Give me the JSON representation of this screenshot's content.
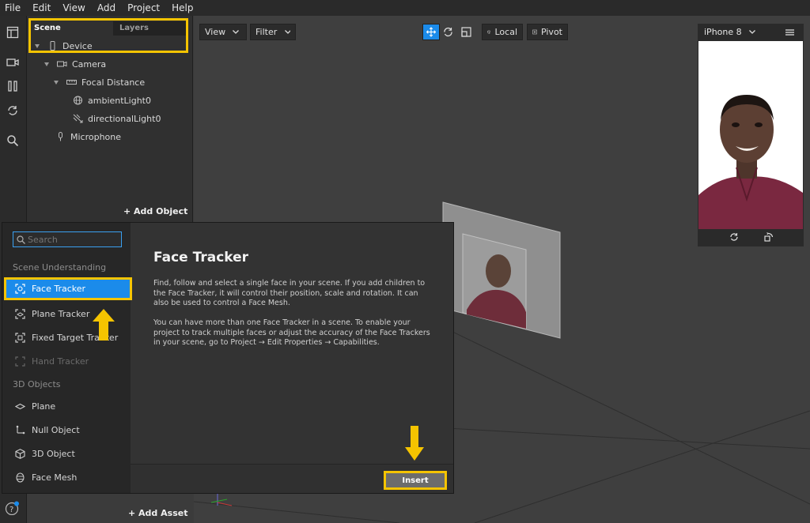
{
  "menu": [
    "File",
    "Edit",
    "View",
    "Add",
    "Project",
    "Help"
  ],
  "scene_panel": {
    "tab_scene": "Scene",
    "tab_layers": "Layers",
    "tree": [
      "Device",
      "Camera",
      "Focal Distance",
      "ambientLight0",
      "directionalLight0",
      "Microphone"
    ],
    "add_object": "Add Object"
  },
  "viewport": {
    "view_label": "View",
    "filter_label": "Filter",
    "local_label": "Local",
    "pivot_label": "Pivot"
  },
  "simulator": {
    "device": "iPhone 8"
  },
  "dialog": {
    "search_placeholder": "Search",
    "section_scene": "Scene Understanding",
    "items_scene": [
      "Face Tracker",
      "Plane Tracker",
      "Fixed Target Tracker",
      "Hand Tracker"
    ],
    "section_3d": "3D Objects",
    "items_3d": [
      "Plane",
      "Null Object",
      "3D Object",
      "Face Mesh"
    ],
    "title": "Face Tracker",
    "desc1": "Find, follow and select a single face in your scene. If you add children to the Face Tracker, it will control their position, scale and rotation. It can also be used to control a Face Mesh.",
    "desc2": "You can have more than one Face Tracker in a scene. To enable your project to track multiple faces or adjust the accuracy of the Face Trackers in your scene, go to Project → Edit Properties → Capabilities.",
    "insert_label": "Insert"
  },
  "add_asset": "Add Asset",
  "colors": {
    "accent": "#1b8bea",
    "highlight": "#f5c400"
  }
}
